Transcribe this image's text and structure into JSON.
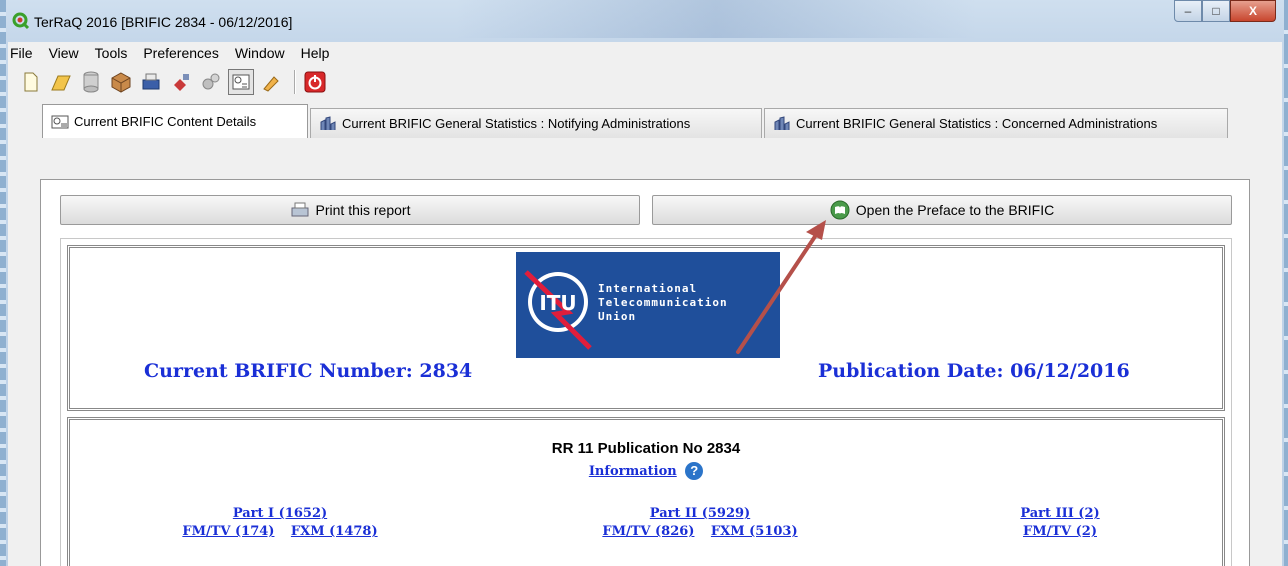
{
  "window": {
    "title": "TerRaQ 2016 [BRIFIC 2834 - 06/12/2016]",
    "controls": {
      "minimize": "‒",
      "maximize": "□",
      "close": "X"
    }
  },
  "menu": [
    "File",
    "View",
    "Tools",
    "Preferences",
    "Window",
    "Help"
  ],
  "toolbar": {
    "icons": [
      "new-file-icon",
      "open-folder-icon",
      "database-icon",
      "package-icon",
      "printer-icon",
      "satellite-icon",
      "gears-icon",
      "brific-icon",
      "edit-icon",
      "power-icon"
    ]
  },
  "tabs": [
    {
      "label": "Current BRIFIC Content Details",
      "active": true
    },
    {
      "label": "Current BRIFIC General Statistics : Notifying Administrations",
      "active": false
    },
    {
      "label": "Current BRIFIC General Statistics : Concerned Administrations",
      "active": false
    }
  ],
  "actions": {
    "print_label": "Print this report",
    "preface_label": "Open the Preface to the BRIFIC"
  },
  "report": {
    "logo_lines": [
      "International",
      "Telecommunication",
      "Union"
    ],
    "logo_mark": "ITU",
    "brific_number": "Current BRIFIC Number: 2834",
    "publication_date": "Publication Date: 06/12/2016",
    "publication_title": "RR 11 Publication No 2834",
    "information_link": "Information",
    "help_glyph": "?",
    "parts": [
      {
        "title": "Part I (1652)",
        "links": [
          "FM/TV (174)",
          "FXM (1478)"
        ]
      },
      {
        "title": "Part II (5929)",
        "links": [
          "FM/TV (826)",
          "FXM (5103)"
        ]
      },
      {
        "title": "Part III (2)",
        "links": [
          "FM/TV (2)"
        ]
      }
    ]
  },
  "colors": {
    "link_blue": "#1a2fd6",
    "logo_blue": "#1f4f9b",
    "arrow_red": "#b5504a"
  }
}
